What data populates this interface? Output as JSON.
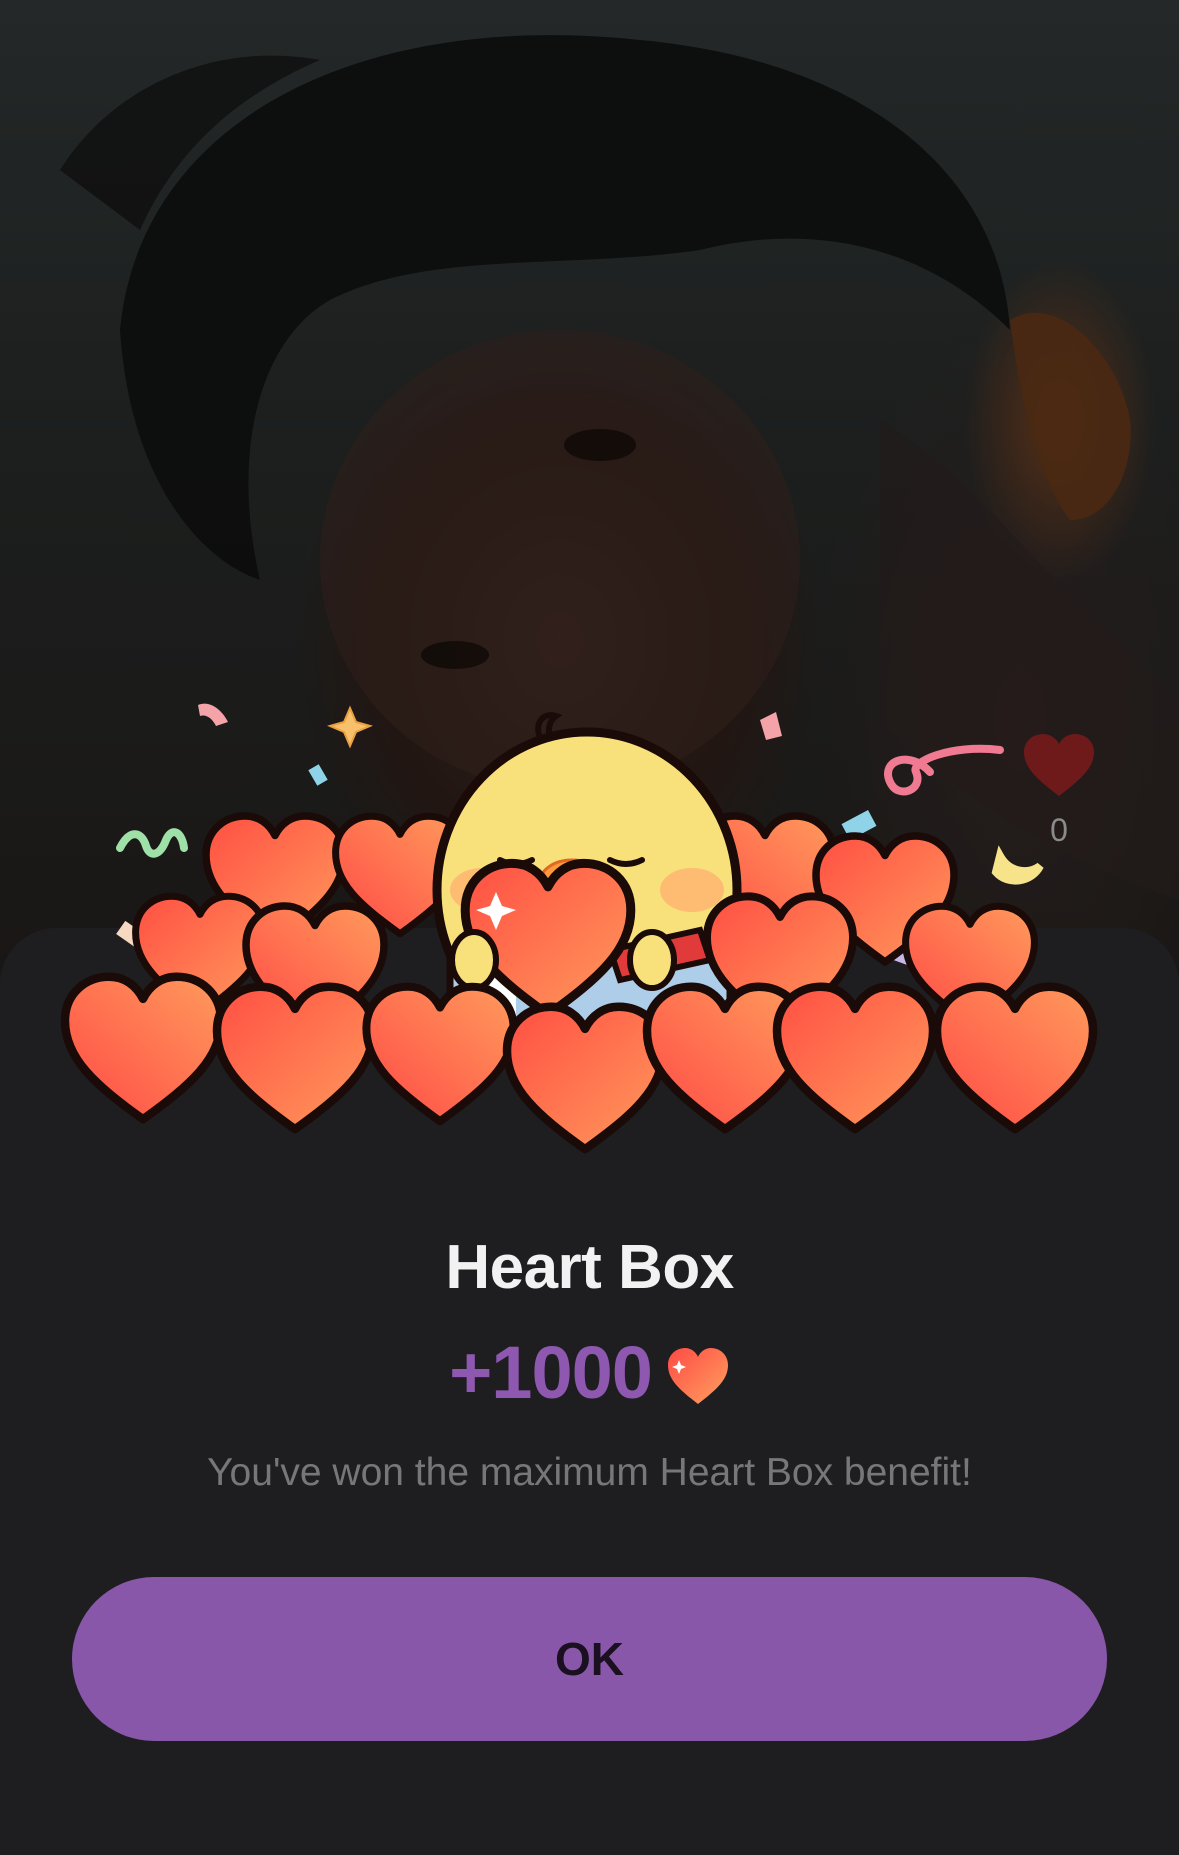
{
  "video": {
    "like_count": "0"
  },
  "dialog": {
    "title": "Heart Box",
    "reward_amount": "+1000",
    "message": "You've won the maximum Heart Box benefit!",
    "ok_label": "OK"
  },
  "icons": {
    "like": "heart-icon",
    "reward": "heart-icon",
    "illustration": "chick-holding-heart-in-heart-pile"
  },
  "colors": {
    "accent": "#8957a9",
    "reward_text": "#8e58b0",
    "sheet_background": "#1e1e20",
    "heart": "#ff6a4d"
  }
}
